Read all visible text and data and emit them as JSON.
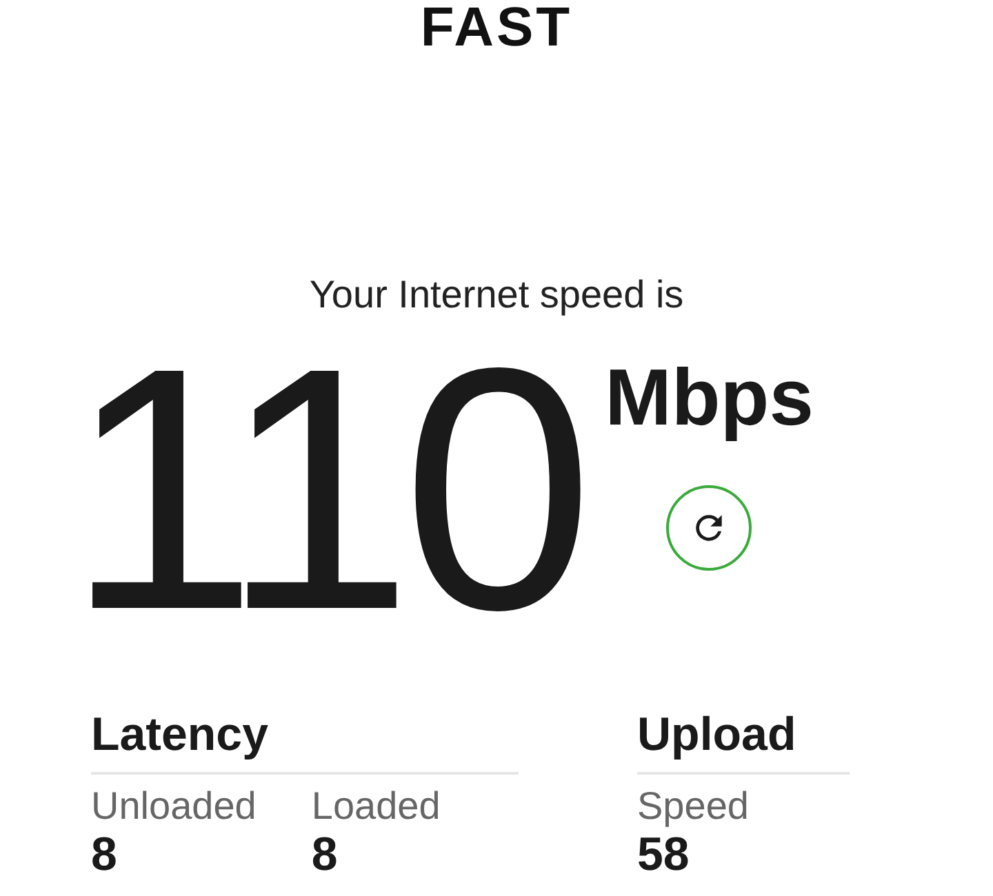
{
  "logo": "FAST",
  "speed": {
    "caption": "Your Internet speed is",
    "value": "110",
    "unit": "Mbps"
  },
  "sections": [
    {
      "title": "Latency",
      "metrics": [
        {
          "label": "Unloaded",
          "value": "8"
        },
        {
          "label": "Loaded",
          "value": "8"
        }
      ]
    },
    {
      "title": "Upload",
      "metrics": [
        {
          "label": "Speed",
          "value": "58"
        }
      ]
    }
  ]
}
